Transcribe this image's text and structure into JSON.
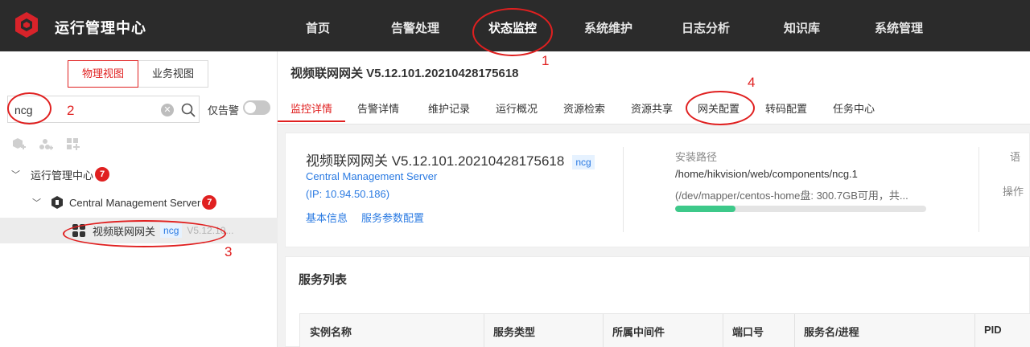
{
  "app": {
    "title": "运行管理中心"
  },
  "nav": {
    "items": [
      {
        "label": "首页"
      },
      {
        "label": "告警处理"
      },
      {
        "label": "状态监控",
        "active": true
      },
      {
        "label": "系统维护"
      },
      {
        "label": "日志分析"
      },
      {
        "label": "知识库"
      },
      {
        "label": "系统管理"
      }
    ]
  },
  "left": {
    "view_tabs": [
      {
        "label": "物理视图",
        "active": true
      },
      {
        "label": "业务视图"
      }
    ],
    "search": {
      "value": "ncg"
    },
    "alarm_only_label": "仅告警",
    "tree": {
      "root": {
        "label": "运行管理中心",
        "badge": "7"
      },
      "server": {
        "label": "Central Management Server",
        "badge": "7"
      },
      "gateway": {
        "label": "视频联网网关",
        "tag": "ncg",
        "version": "V5.12.10..."
      }
    }
  },
  "main": {
    "title": "视频联网网关 V5.12.101.20210428175618",
    "tabs": [
      {
        "label": "监控详情",
        "active": true
      },
      {
        "label": "告警详情"
      },
      {
        "label": "维护记录"
      },
      {
        "label": "运行概况"
      },
      {
        "label": "资源检索"
      },
      {
        "label": "资源共享"
      },
      {
        "label": "网关配置"
      },
      {
        "label": "转码配置"
      },
      {
        "label": "任务中心"
      }
    ],
    "card": {
      "title": "视频联网网关 V5.12.101.20210428175618",
      "tag": "ncg",
      "server_link": "Central Management Server",
      "ip_link": "(IP: 10.94.50.186)",
      "links": [
        "基本信息",
        "服务参数配置"
      ],
      "install_path_label": "安装路径",
      "install_path_value": "/home/hikvision/web/components/ncg.1",
      "disk_info": "(/dev/mapper/centos-home盘: 300.7GB可用，共...",
      "disk_usage_fraction": 0.24,
      "side_label_1": "语",
      "side_label_2": "操作"
    },
    "service": {
      "title": "服务列表",
      "columns": [
        "实例名称",
        "服务类型",
        "所属中间件",
        "端口号",
        "服务名/进程",
        "PID"
      ]
    }
  },
  "annotations": [
    "1",
    "2",
    "3",
    "4"
  ],
  "colors": {
    "accent": "#e02020",
    "link": "#2a7ae2",
    "progress": "#3dc98a",
    "topbar": "#2b2b2b"
  }
}
